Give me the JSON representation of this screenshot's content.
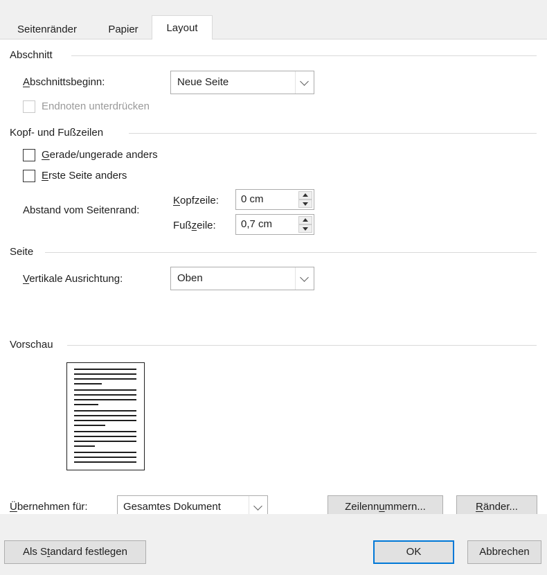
{
  "tabs": [
    {
      "label": "Seitenränder"
    },
    {
      "label": "Papier"
    },
    {
      "label": "Layout"
    }
  ],
  "abschnitt": {
    "title": "Abschnitt",
    "beginn_label_u": "A",
    "beginn_label_rest": "bschnittsbeginn:",
    "beginn_value": "Neue Seite",
    "endnoten_label": "Endnoten unterdrücken"
  },
  "kopf": {
    "title": "Kopf- und Fußzeilen",
    "gerade_u": "G",
    "gerade_rest": "erade/ungerade anders",
    "erste_u": "E",
    "erste_rest": "rste Seite anders",
    "abstand_label": "Abstand vom Seitenrand:",
    "kopfzeile_u": "K",
    "kopfzeile_rest": "opfzeile:",
    "kopfzeile_value": "0 cm",
    "fusszeile_pre": "Fuß",
    "fusszeile_u": "z",
    "fusszeile_post": "eile:",
    "fusszeile_value": "0,7 cm"
  },
  "seite": {
    "title": "Seite",
    "vertikal_u": "V",
    "vertikal_rest": "ertikale Ausrichtung:",
    "vertikal_value": "Oben"
  },
  "vorschau": {
    "title": "Vorschau"
  },
  "apply": {
    "label_u": "Ü",
    "label_rest": "bernehmen für:",
    "value": "Gesamtes Dokument",
    "zeilennummern_pre": "Zeilenn",
    "zeilennummern_u": "u",
    "zeilennummern_post": "mmern...",
    "raender_u": "R",
    "raender_rest": "änder..."
  },
  "footer": {
    "standard_pre": "Als S",
    "standard_u": "t",
    "standard_post": "andard festlegen",
    "ok": "OK",
    "cancel": "Abbrechen"
  }
}
